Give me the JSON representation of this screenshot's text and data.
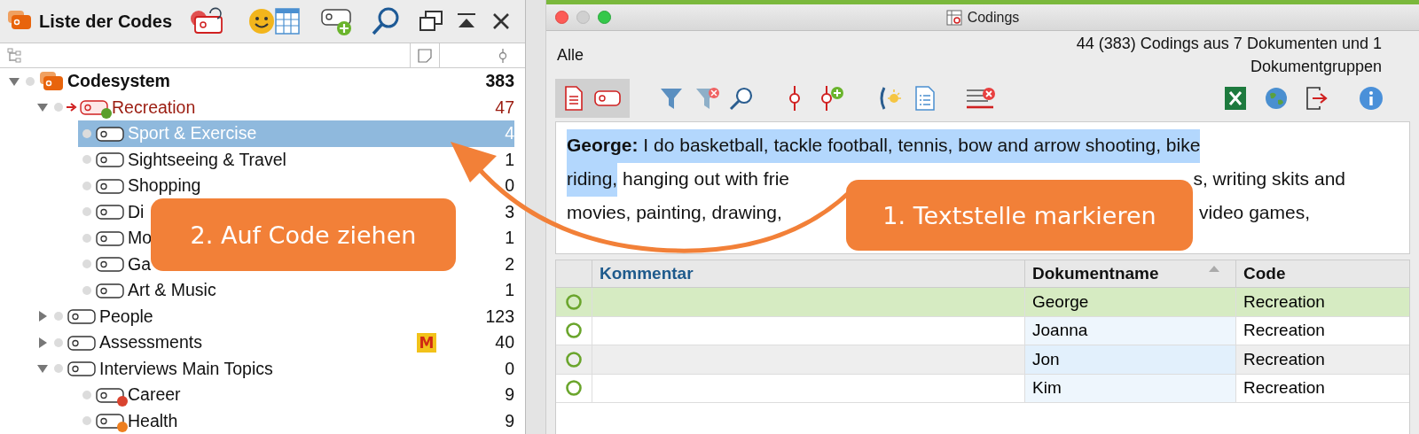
{
  "code_list": {
    "title": "Liste der Codes",
    "tree": [
      {
        "label": "Codesystem",
        "count": "383",
        "kind": "root",
        "selected": false,
        "expanded": true,
        "children": [
          {
            "label": "Recreation",
            "count": "47",
            "kind": "code",
            "selected": false,
            "activated": true,
            "color": "#5a9e2a",
            "expanded": true,
            "children": [
              {
                "label": "Sport & Exercise",
                "count": "4",
                "kind": "code",
                "selected": true,
                "activated": false
              },
              {
                "label": "Sightseeing & Travel",
                "count": "1",
                "kind": "code",
                "selected": false,
                "activated": false
              },
              {
                "label": "Shopping",
                "count": "0",
                "kind": "code",
                "selected": false,
                "activated": false
              },
              {
                "label": "Di",
                "count": "3",
                "kind": "code",
                "selected": false,
                "activated": false
              },
              {
                "label": "Mo",
                "count": "1",
                "kind": "code",
                "selected": false,
                "activated": false
              },
              {
                "label": "Ga",
                "count": "2",
                "kind": "code",
                "selected": false,
                "activated": false
              },
              {
                "label": "Art & Music",
                "count": "1",
                "kind": "code",
                "selected": false,
                "activated": false
              }
            ]
          },
          {
            "label": "People",
            "count": "123",
            "kind": "code",
            "selected": false,
            "activated": false,
            "expanded": false
          },
          {
            "label": "Assessments",
            "count": "40",
            "kind": "code",
            "selected": false,
            "activated": false,
            "expanded": false,
            "memo": "M"
          },
          {
            "label": "Interviews Main Topics",
            "count": "0",
            "kind": "code",
            "selected": false,
            "activated": false,
            "expanded": true,
            "children": [
              {
                "label": "Career",
                "count": "9",
                "kind": "code",
                "selected": false,
                "activated": false,
                "color": "#d9432f"
              },
              {
                "label": "Health",
                "count": "9",
                "kind": "code",
                "selected": false,
                "activated": false,
                "color": "#ee7f1f"
              }
            ]
          }
        ]
      }
    ]
  },
  "codings_window": {
    "title": "Codings",
    "filter_label": "Alle",
    "summary": "44 (383) Codings aus 7 Dokumenten und 1 Dokumentgruppen",
    "document": {
      "speaker": "George:",
      "lines": [
        {
          "left": [
            {
              "text": "I do basketball, tackle football, tennis, bow and arrow shooting, bike",
              "highlighted": true
            }
          ]
        },
        {
          "left": [
            {
              "text": "riding,",
              "highlighted": true
            },
            {
              "text": " hanging out with frie",
              "highlighted": false
            }
          ],
          "right": "s, writing skits and"
        },
        {
          "left": [
            {
              "text": "movies, painting, drawing,",
              "highlighted": false
            }
          ],
          "right": "video games,"
        }
      ]
    },
    "table": {
      "columns": [
        {
          "label": "Kommentar",
          "sorted": false
        },
        {
          "label": "Dokumentname",
          "sorted": true
        },
        {
          "label": "Code",
          "sorted": false
        }
      ],
      "rows": [
        {
          "document": "George",
          "code": "Recreation",
          "selected": true
        },
        {
          "document": "Joanna",
          "code": "Recreation",
          "selected": false
        },
        {
          "document": "Jon",
          "code": "Recreation",
          "selected": false
        },
        {
          "document": "Kim",
          "code": "Recreation",
          "selected": false
        }
      ]
    }
  },
  "annotations": [
    {
      "text": "2. Auf Code ziehen"
    },
    {
      "text": "1. Textstelle markieren"
    }
  ]
}
